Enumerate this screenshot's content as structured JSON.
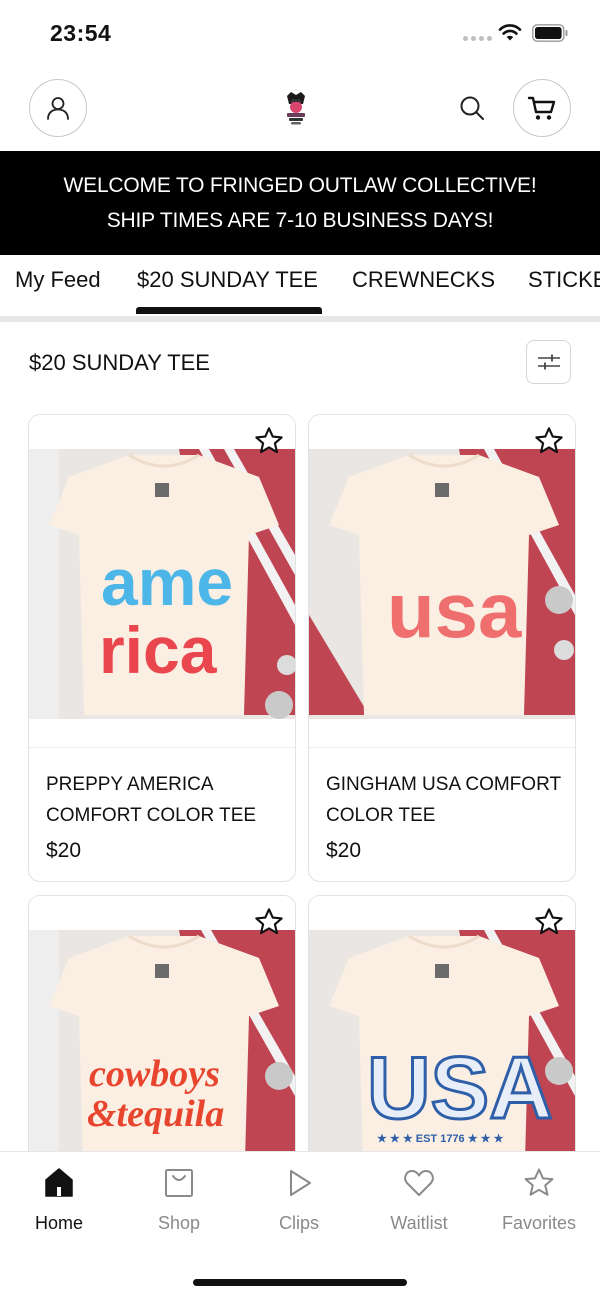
{
  "status_bar": {
    "time": "23:54"
  },
  "header": {
    "account_icon": "person-icon",
    "logo_icon": "brand-logo-icon",
    "search_icon": "search-icon",
    "cart_icon": "cart-icon"
  },
  "banner": {
    "line1": "WELCOME TO FRINGED OUTLAW COLLECTIVE!",
    "line2": "SHIP TIMES ARE 7-10 BUSINESS DAYS!"
  },
  "tabs": [
    {
      "label": "My Feed"
    },
    {
      "label": "$20 SUNDAY TEE",
      "active": true
    },
    {
      "label": "CREWNECKS"
    },
    {
      "label": "STICKE"
    }
  ],
  "section": {
    "title": "$20 SUNDAY TEE",
    "filter_icon": "sliders-icon"
  },
  "products": [
    {
      "title": "PREPPY AMERICA COMFORT COLOR TEE",
      "price": "$20",
      "art_text_1": "ame",
      "art_text_2": "rica"
    },
    {
      "title": "GINGHAM USA COMFORT COLOR TEE",
      "price": "$20",
      "art_text_1": "usa"
    },
    {
      "title": "",
      "price": "",
      "art_text_1": "cowboys",
      "art_text_2": "&tequila"
    },
    {
      "title": "",
      "price": "",
      "art_text_1": "USA",
      "art_text_2": "★ ★ ★ EST 1776 ★ ★ ★"
    }
  ],
  "bottom_nav": [
    {
      "label": "Home",
      "icon": "home-icon",
      "active": true
    },
    {
      "label": "Shop",
      "icon": "shopping-bag-icon"
    },
    {
      "label": "Clips",
      "icon": "play-icon"
    },
    {
      "label": "Waitlist",
      "icon": "heart-icon"
    },
    {
      "label": "Favorites",
      "icon": "star-icon"
    }
  ],
  "colors": {
    "banner_bg": "#000000",
    "active_text": "#111111",
    "inactive_text": "#8a8a8a",
    "accent_red": "#c8283a",
    "accent_blue": "#2f7fd6"
  }
}
